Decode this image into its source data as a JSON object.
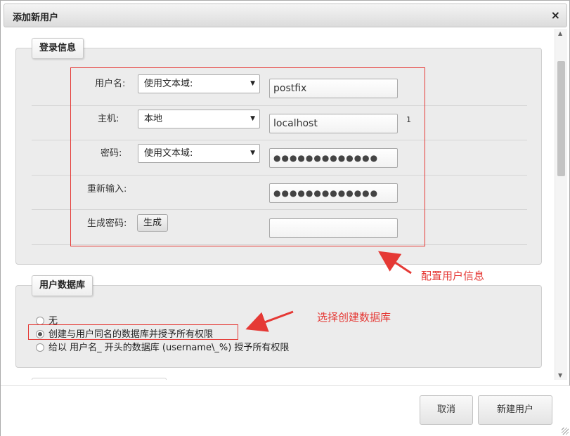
{
  "dialog": {
    "title": "添加新用户",
    "close_icon": "×"
  },
  "login": {
    "legend": "登录信息",
    "rows": {
      "username": {
        "label": "用户名:",
        "select": "使用文本域:",
        "value": "postfix"
      },
      "host": {
        "label": "主机:",
        "select": "本地",
        "value": "localhost",
        "note": "1"
      },
      "password": {
        "label": "密码:",
        "select": "使用文本域:",
        "value": "●●●●●●●●●●●●●"
      },
      "retype": {
        "label": "重新输入:",
        "value": "●●●●●●●●●●●●●"
      },
      "generate": {
        "label": "生成密码:",
        "button": "生成",
        "value": ""
      }
    }
  },
  "userdb": {
    "legend": "用户数据库",
    "options": [
      {
        "label": "无",
        "checked": false
      },
      {
        "label": "创建与用户同名的数据库并授予所有权限",
        "checked": true
      },
      {
        "label": "给以 用户名_ 开头的数据库 (username\\_%) 授予所有权限",
        "checked": false
      }
    ]
  },
  "annotations": {
    "config_user_info": "配置用户信息",
    "select_create_db": "选择创建数据库",
    "color": "#e53935"
  },
  "footer": {
    "cancel": "取消",
    "create_user": "新建用户"
  },
  "icons": {
    "select_arrow": "▼",
    "scroll_up": "▲",
    "scroll_down": "▼"
  }
}
